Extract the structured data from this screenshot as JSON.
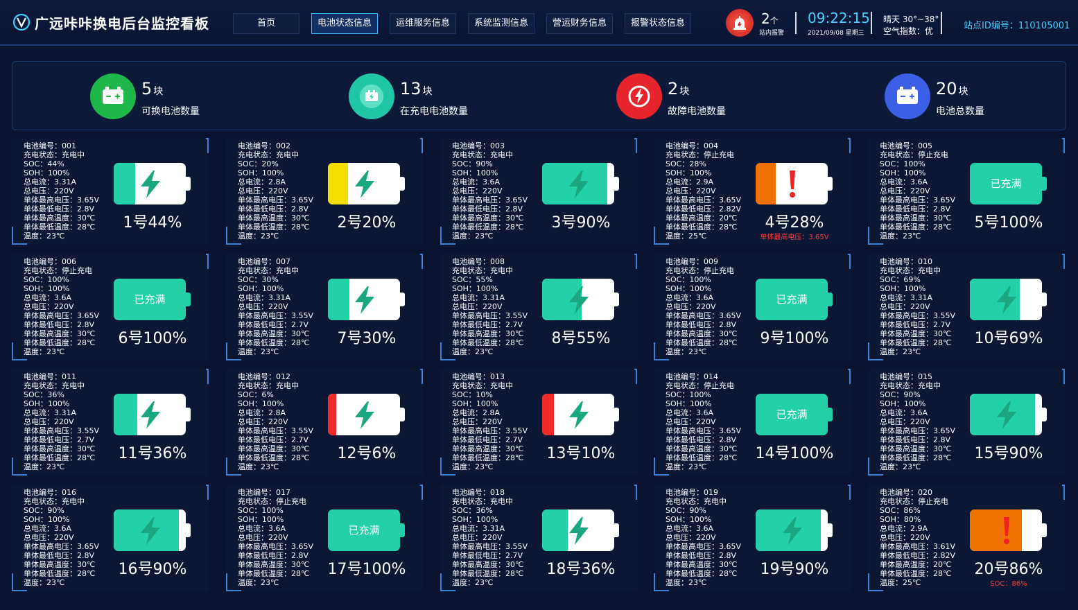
{
  "header": {
    "title": "广远咔咔换电后台监控看板",
    "nav": [
      "首页",
      "电池状态信息",
      "运维服务信息",
      "系统监测信息",
      "营运财务信息",
      "报警状态信息"
    ],
    "active_nav": "电池状态信息",
    "alarm": {
      "count": "2",
      "unit": "个",
      "label": "站内报警"
    },
    "time": "09:22:15",
    "date": "2021/09/08  星期三",
    "weather": "晴天 30°~38°",
    "air": "空气指数：优",
    "station": "站点ID编号：110105001"
  },
  "summary": [
    {
      "value": "5",
      "unit": "块",
      "label": "可换电池数量",
      "color": "#1fb64a",
      "icon": "battery-icon"
    },
    {
      "value": "13",
      "unit": "块",
      "label": "在充电电池数量",
      "color": "#1fc7a5",
      "icon": "charging-icon"
    },
    {
      "value": "2",
      "unit": "块",
      "label": "故障电池数量",
      "color": "#e6242b",
      "icon": "fault-icon"
    },
    {
      "value": "20",
      "unit": "块",
      "label": "电池总数量",
      "color": "#3b5fe6",
      "icon": "battery-total-icon"
    }
  ],
  "colors": {
    "fill_normal": "#24d0a8",
    "fill_yellow": "#f2df00",
    "fill_red": "#ee2a2a",
    "fill_orange": "#f07000",
    "accent": "#45d0ff"
  },
  "batteries": [
    {
      "id": "001",
      "status": "充电中",
      "soc": "44%",
      "soh": "100%",
      "current": "3.31A",
      "voltage": "220V",
      "vmax": "3.65V",
      "vmin": "2.8V",
      "tmax": "30℃",
      "tmin": "28℃",
      "temp": "23℃",
      "title": "1号44%",
      "level": 0.3,
      "fill": "fill_normal",
      "mode": "charge",
      "alert": ""
    },
    {
      "id": "002",
      "status": "充电中",
      "soc": "20%",
      "soh": "100%",
      "current": "2.8A",
      "voltage": "220V",
      "vmax": "3.65V",
      "vmin": "2.8V",
      "tmax": "30℃",
      "tmin": "28℃",
      "temp": "23℃",
      "title": "2号20%",
      "level": 0.28,
      "fill": "fill_yellow",
      "mode": "charge",
      "alert": ""
    },
    {
      "id": "003",
      "status": "充电中",
      "soc": "90%",
      "soh": "100%",
      "current": "3.6A",
      "voltage": "220V",
      "vmax": "3.65V",
      "vmin": "2.8V",
      "tmax": "30℃",
      "tmin": "28℃",
      "temp": "23℃",
      "title": "3号90%",
      "level": 0.9,
      "fill": "fill_normal",
      "mode": "charge",
      "alert": ""
    },
    {
      "id": "004",
      "status": "停止充电",
      "soc": "28%",
      "soh": "100%",
      "current": "2.9A",
      "voltage": "220V",
      "vmax": "3.65V",
      "vmin": "2.82V",
      "tmax": "20℃",
      "tmin": "28℃",
      "temp": "25℃",
      "title": "4号28%",
      "level": 0.28,
      "fill": "fill_orange",
      "mode": "fault",
      "alert": "单体最高电压：3.65V"
    },
    {
      "id": "005",
      "status": "停止充电",
      "soc": "100%",
      "soh": "100%",
      "current": "3.6A",
      "voltage": "220V",
      "vmax": "3.65V",
      "vmin": "2.8V",
      "tmax": "30℃",
      "tmin": "28℃",
      "temp": "23℃",
      "title": "5号100%",
      "level": 1.0,
      "fill": "fill_normal",
      "mode": "full",
      "alert": ""
    },
    {
      "id": "006",
      "status": "停止充电",
      "soc": "100%",
      "soh": "100%",
      "current": "3.6A",
      "voltage": "220V",
      "vmax": "3.65V",
      "vmin": "2.8V",
      "tmax": "30℃",
      "tmin": "28℃",
      "temp": "23℃",
      "title": "6号100%",
      "level": 1.0,
      "fill": "fill_normal",
      "mode": "full",
      "alert": ""
    },
    {
      "id": "007",
      "status": "充电中",
      "soc": "30%",
      "soh": "100%",
      "current": "3.31A",
      "voltage": "220V",
      "vmax": "3.55V",
      "vmin": "2.7V",
      "tmax": "30℃",
      "tmin": "28℃",
      "temp": "23℃",
      "title": "7号30%",
      "level": 0.3,
      "fill": "fill_normal",
      "mode": "charge",
      "alert": ""
    },
    {
      "id": "008",
      "status": "充电中",
      "soc": "55%",
      "soh": "100%",
      "current": "3.31A",
      "voltage": "220V",
      "vmax": "3.55V",
      "vmin": "2.7V",
      "tmax": "30℃",
      "tmin": "28℃",
      "temp": "23℃",
      "title": "8号55%",
      "level": 0.55,
      "fill": "fill_normal",
      "mode": "charge",
      "alert": ""
    },
    {
      "id": "009",
      "status": "停止充电",
      "soc": "100%",
      "soh": "100%",
      "current": "3.6A",
      "voltage": "220V",
      "vmax": "3.65V",
      "vmin": "2.8V",
      "tmax": "30℃",
      "tmin": "28℃",
      "temp": "23℃",
      "title": "9号100%",
      "level": 1.0,
      "fill": "fill_normal",
      "mode": "full",
      "alert": ""
    },
    {
      "id": "010",
      "status": "充电中",
      "soc": "69%",
      "soh": "100%",
      "current": "3.31A",
      "voltage": "220V",
      "vmax": "3.55V",
      "vmin": "2.7V",
      "tmax": "30℃",
      "tmin": "28℃",
      "temp": "23℃",
      "title": "10号69%",
      "level": 0.69,
      "fill": "fill_normal",
      "mode": "charge",
      "alert": ""
    },
    {
      "id": "011",
      "status": "充电中",
      "soc": "36%",
      "soh": "100%",
      "current": "3.31A",
      "voltage": "220V",
      "vmax": "3.55V",
      "vmin": "2.7V",
      "tmax": "30℃",
      "tmin": "28℃",
      "temp": "23℃",
      "title": "11号36%",
      "level": 0.33,
      "fill": "fill_normal",
      "mode": "charge",
      "alert": ""
    },
    {
      "id": "012",
      "status": "充电中",
      "soc": "6%",
      "soh": "100%",
      "current": "2.8A",
      "voltage": "220V",
      "vmax": "3.55V",
      "vmin": "2.7V",
      "tmax": "30℃",
      "tmin": "28℃",
      "temp": "23℃",
      "title": "12号6%",
      "level": 0.12,
      "fill": "fill_red",
      "mode": "charge",
      "alert": ""
    },
    {
      "id": "013",
      "status": "充电中",
      "soc": "10%",
      "soh": "100%",
      "current": "2.8A",
      "voltage": "220V",
      "vmax": "3.55V",
      "vmin": "2.7V",
      "tmax": "30℃",
      "tmin": "28℃",
      "temp": "23℃",
      "title": "13号10%",
      "level": 0.16,
      "fill": "fill_red",
      "mode": "charge",
      "alert": ""
    },
    {
      "id": "014",
      "status": "停止充电",
      "soc": "100%",
      "soh": "100%",
      "current": "3.6A",
      "voltage": "220V",
      "vmax": "3.65V",
      "vmin": "2.8V",
      "tmax": "30℃",
      "tmin": "28℃",
      "temp": "23℃",
      "title": "14号100%",
      "level": 1.0,
      "fill": "fill_normal",
      "mode": "full",
      "alert": ""
    },
    {
      "id": "015",
      "status": "充电中",
      "soc": "90%",
      "soh": "100%",
      "current": "3.6A",
      "voltage": "220V",
      "vmax": "3.65V",
      "vmin": "2.8V",
      "tmax": "30℃",
      "tmin": "28℃",
      "temp": "23℃",
      "title": "15号90%",
      "level": 0.9,
      "fill": "fill_normal",
      "mode": "charge",
      "alert": ""
    },
    {
      "id": "016",
      "status": "充电中",
      "soc": "90%",
      "soh": "100%",
      "current": "3.6A",
      "voltage": "220V",
      "vmax": "3.65V",
      "vmin": "2.8V",
      "tmax": "30℃",
      "tmin": "28℃",
      "temp": "23℃",
      "title": "16号90%",
      "level": 0.9,
      "fill": "fill_normal",
      "mode": "charge",
      "alert": ""
    },
    {
      "id": "017",
      "status": "停止充电",
      "soc": "100%",
      "soh": "100%",
      "current": "3.6A",
      "voltage": "220V",
      "vmax": "3.65V",
      "vmin": "2.8V",
      "tmax": "30℃",
      "tmin": "28℃",
      "temp": "23℃",
      "title": "17号100%",
      "level": 1.0,
      "fill": "fill_normal",
      "mode": "full",
      "alert": ""
    },
    {
      "id": "018",
      "status": "充电中",
      "soc": "36%",
      "soh": "100%",
      "current": "3.31A",
      "voltage": "220V",
      "vmax": "3.55V",
      "vmin": "2.7V",
      "tmax": "30℃",
      "tmin": "28℃",
      "temp": "23℃",
      "title": "18号36%",
      "level": 0.36,
      "fill": "fill_normal",
      "mode": "charge",
      "alert": ""
    },
    {
      "id": "019",
      "status": "充电中",
      "soc": "90%",
      "soh": "100%",
      "current": "3.6A",
      "voltage": "220V",
      "vmax": "3.65V",
      "vmin": "2.8V",
      "tmax": "30℃",
      "tmin": "28℃",
      "temp": "23℃",
      "title": "19号90%",
      "level": 0.9,
      "fill": "fill_normal",
      "mode": "charge",
      "alert": ""
    },
    {
      "id": "020",
      "status": "停止充电",
      "soc": "86%",
      "soh": "80%",
      "current": "2.9A",
      "voltage": "220V",
      "vmax": "3.61V",
      "vmin": "2.82V",
      "tmax": "20℃",
      "tmin": "28℃",
      "temp": "25℃",
      "title": "20号86%",
      "level": 0.72,
      "fill": "fill_orange",
      "mode": "fault",
      "alert": "SOC：86%"
    }
  ],
  "labels": {
    "id": "电池编号：",
    "status": "充电状态：",
    "soc": "SOC：",
    "soh": "SOH：",
    "current": "总电流：",
    "voltage": "总电压：",
    "vmax": "单体最高电压：",
    "vmin": "单体最低电压：",
    "tmax": "单体最高温度：",
    "tmin": "单体最低温度：",
    "temp": "温度：",
    "full": "已充满"
  }
}
